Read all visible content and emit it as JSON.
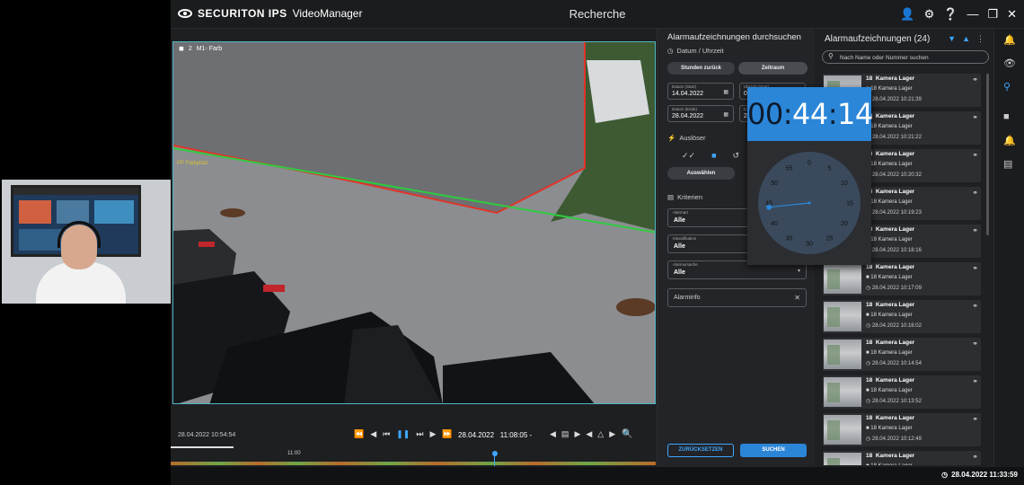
{
  "app": {
    "logo_brand": "SECURITON IPS",
    "logo_product": "VideoManager",
    "page_title": "Recherche",
    "title_icons": [
      "user-icon",
      "gear-icon",
      "help-icon",
      "minimize-icon",
      "restore-icon",
      "close-icon"
    ]
  },
  "video": {
    "camera_number": "2",
    "camera_name": "M1- Farb",
    "zone_label": "PP Parkplatz"
  },
  "playback": {
    "timestamp_left": "28.04.2022 10:54:54",
    "current_date": "28.04.2022",
    "current_time": "11:08:05 -",
    "timeline_label": "11:00",
    "progress": 0.13
  },
  "search": {
    "title": "Alarmaufzeichnungen durchsuchen",
    "section_datetime": "Datum / Uhrzeit",
    "btn_hours_back": "Stunden zurück",
    "btn_timespan": "Zeitraum",
    "start_date_label": "Datum (Start)",
    "start_date": "14.04.2022",
    "start_time_label": "Uhrzeit (Start)",
    "start_time": "0",
    "end_date_label": "Datum (Ende)",
    "end_date": "28.04.2022",
    "end_time_label": "U",
    "end_time": "2",
    "section_trigger": "Auslöser",
    "btn_select": "Auswählen",
    "section_criteria": "Kriterien",
    "alarm_type_label": "Alarmart",
    "alarm_type": "Alle",
    "classification_label": "Klassifikation",
    "classification": "Alle",
    "alarm_cause_label": "Alarmursache",
    "alarm_cause": "Alle",
    "alarm_info_placeholder": "Alarminfo",
    "btn_reset": "ZURÜCKSETZEN",
    "btn_search": "SUCHEN"
  },
  "timepicker": {
    "hours": "00",
    "minutes": "44",
    "seconds": "14",
    "dial_labels": [
      "0",
      "5",
      "10",
      "15",
      "20",
      "25",
      "30",
      "35",
      "40",
      "45",
      "50",
      "55"
    ],
    "selected_minute": 44
  },
  "results": {
    "title": "Alarmaufzeichnungen (24)",
    "search_placeholder": "Nach Name oder Nummer suchen",
    "items": [
      {
        "number": "18",
        "name": "Kamera Lager",
        "camera": "18  Kamera Lager",
        "time": "28.04.2022 10:21:39"
      },
      {
        "number": "18",
        "name": "Kamera Lager",
        "camera": "18  Kamera Lager",
        "time": "28.04.2022 10:21:22"
      },
      {
        "number": "18",
        "name": "Kamera Lager",
        "camera": "18  Kamera Lager",
        "time": "28.04.2022 10:20:32"
      },
      {
        "number": "18",
        "name": "Kamera Lager",
        "camera": "18  Kamera Lager",
        "time": "28.04.2022 10:19:23"
      },
      {
        "number": "18",
        "name": "Kamera Lager",
        "camera": "18  Kamera Lager",
        "time": "28.04.2022 10:18:16"
      },
      {
        "number": "18",
        "name": "Kamera Lager",
        "camera": "18  Kamera Lager",
        "time": "28.04.2022 10:17:09"
      },
      {
        "number": "18",
        "name": "Kamera Lager",
        "camera": "18  Kamera Lager",
        "time": "28.04.2022 10:16:02"
      },
      {
        "number": "18",
        "name": "Kamera Lager",
        "camera": "18  Kamera Lager",
        "time": "28.04.2022 10:14:54"
      },
      {
        "number": "18",
        "name": "Kamera Lager",
        "camera": "18  Kamera Lager",
        "time": "28.04.2022 10:13:52"
      },
      {
        "number": "18",
        "name": "Kamera Lager",
        "camera": "18  Kamera Lager",
        "time": "28.04.2022 10:12:49"
      },
      {
        "number": "18",
        "name": "Kamera Lager",
        "camera": "18  Kamera Lager",
        "time": ""
      }
    ]
  },
  "rail": {
    "icons": [
      "bell-icon",
      "eye-icon",
      "search-icon",
      "camera-icon",
      "alarm-icon",
      "film-icon"
    ],
    "active": "search-icon"
  },
  "status": {
    "datetime": "28.04.2022 11:33:59"
  },
  "colors": {
    "accent": "#2b86d8",
    "background": "#1e1f21",
    "panel": "#232427"
  }
}
